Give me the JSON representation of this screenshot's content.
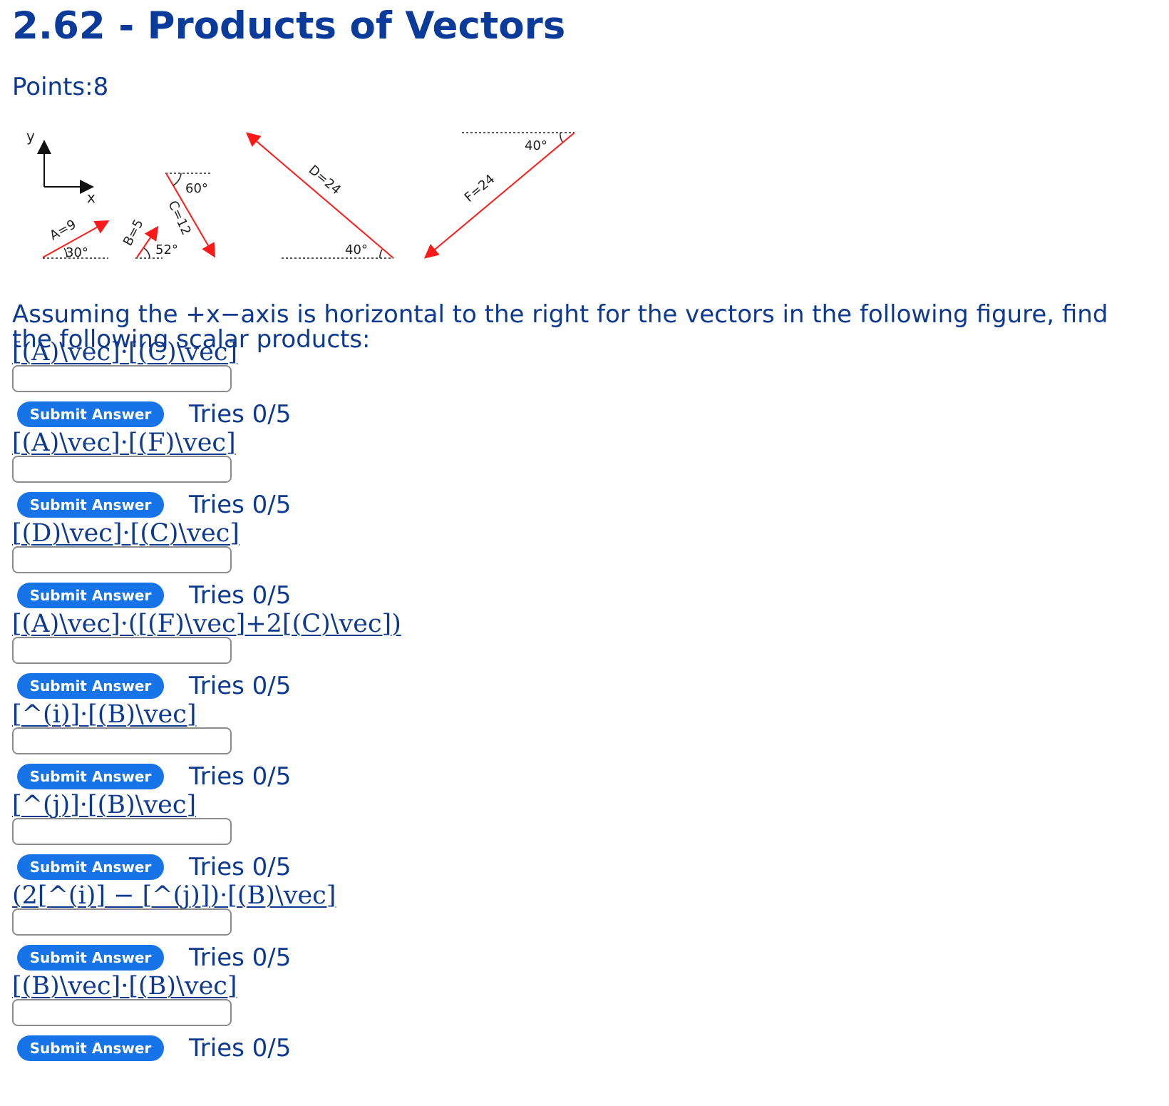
{
  "page": {
    "title": "2.62 - Products of Vectors",
    "points_label": "Points:8",
    "prompt": "Assuming the +x−axis is horizontal to the right for the vectors in the following figure, find the following scalar products:"
  },
  "figure": {
    "axis_y_label": "y",
    "axis_x_label": "x",
    "vectors": {
      "A": {
        "label": "A=9",
        "angle_label": "30°"
      },
      "B": {
        "label": "B=5",
        "angle_label": "52°"
      },
      "C": {
        "label": "C=12",
        "angle_label": "60°"
      },
      "D": {
        "label": "D=24",
        "angle_label": "40°"
      },
      "F": {
        "label": "F=24",
        "angle_label": "40°"
      }
    },
    "arrow_color": "#ff0000"
  },
  "questions": [
    {
      "expression": "[(A)\\vec]·[(C)\\vec]",
      "input_value": "",
      "submit_label": "Submit Answer",
      "tries": "Tries 0/5"
    },
    {
      "expression": "[(A)\\vec]·[(F)\\vec]",
      "input_value": "",
      "submit_label": "Submit Answer",
      "tries": "Tries 0/5"
    },
    {
      "expression": "[(D)\\vec]·[(C)\\vec]",
      "input_value": "",
      "submit_label": "Submit Answer",
      "tries": "Tries 0/5"
    },
    {
      "expression": "[(A)\\vec]·([(F)\\vec]+2[(C)\\vec])",
      "input_value": "",
      "submit_label": "Submit Answer",
      "tries": "Tries 0/5"
    },
    {
      "expression": "[^(i)]·[(B)\\vec]",
      "input_value": "",
      "submit_label": "Submit Answer",
      "tries": "Tries 0/5"
    },
    {
      "expression": "[^(j)]·[(B)\\vec]",
      "input_value": "",
      "submit_label": "Submit Answer",
      "tries": "Tries 0/5"
    },
    {
      "expression": "(2[^(i)] − [^(j)])·[(B)\\vec]",
      "input_value": "",
      "submit_label": "Submit Answer",
      "tries": "Tries 0/5"
    },
    {
      "expression": "[(B)\\vec]·[(B)\\vec]",
      "input_value": "",
      "submit_label": "Submit Answer",
      "tries": "Tries 0/5"
    }
  ],
  "colors": {
    "text": "#0d3a8f",
    "button": "#1774e8"
  }
}
